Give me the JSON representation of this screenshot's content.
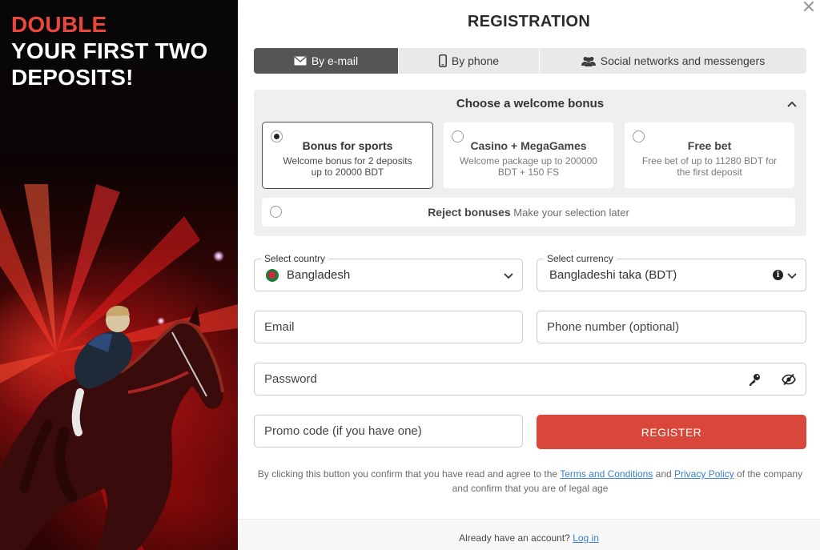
{
  "promo": {
    "line1": "DOUBLE",
    "line2": "YOUR FIRST TWO",
    "line3": "DEPOSITS!"
  },
  "modal": {
    "title": "REGISTRATION",
    "close": "✕"
  },
  "tabs": [
    {
      "label": "By e-mail",
      "icon": "envelope-icon",
      "active": true
    },
    {
      "label": "By phone",
      "icon": "phone-icon",
      "active": false
    },
    {
      "label": "Social networks and messengers",
      "icon": "users-icon",
      "active": false
    }
  ],
  "bonus": {
    "heading": "Choose a welcome bonus",
    "options": [
      {
        "title": "Bonus for sports",
        "desc": "Welcome bonus for 2 deposits up to 20000 BDT",
        "selected": true
      },
      {
        "title": "Casino + MegaGames",
        "desc": "Welcome package up to 200000 BDT + 150 FS",
        "selected": false
      },
      {
        "title": "Free bet",
        "desc": "Free bet of up to 11280 BDT for the first deposit",
        "selected": false
      }
    ],
    "reject_title": "Reject bonuses",
    "reject_desc": "Make your selection later"
  },
  "form": {
    "country_label": "Select country",
    "country_value": "Bangladesh",
    "currency_label": "Select currency",
    "currency_value": "Bangladeshi taka (BDT)",
    "email_placeholder": "Email",
    "phone_placeholder": "Phone number (optional)",
    "password_placeholder": "Password",
    "promo_placeholder": "Promo code (if you have one)",
    "register_label": "REGISTER"
  },
  "legal": {
    "prefix": "By clicking this button you confirm that you have read and agree to the",
    "terms": "Terms and Conditions",
    "and": "and",
    "privacy": "Privacy Policy",
    "suffix": "of the company and confirm that you are of legal age"
  },
  "footer": {
    "question": "Already have an account?",
    "login": "Log in"
  },
  "colors": {
    "accent": "#d9473b",
    "promo_red": "#e8473b",
    "tab_active": "#555555",
    "link": "#3a7fc9"
  }
}
